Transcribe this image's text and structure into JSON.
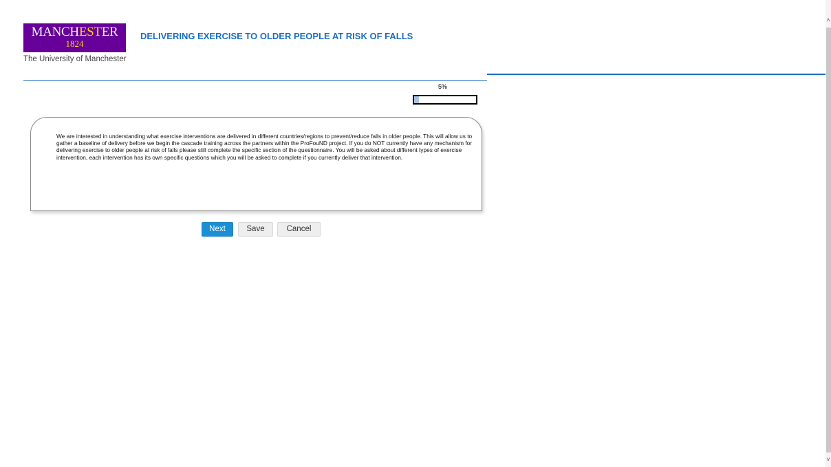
{
  "header": {
    "logo_text_a": "MANCH",
    "logo_text_hl": "EST",
    "logo_text_b": "ER",
    "logo_year": "1824",
    "university_name": "The University of Manchester",
    "title": "DELIVERING EXERCISE TO OLDER PEOPLE AT RISK OF FALLS"
  },
  "progress": {
    "label": "5%",
    "fraction": 0.05
  },
  "intro": {
    "text": "We are interested in understanding what exercise interventions are delivered in different countries/regions to prevent/reduce falls in older people. This will allow us to gather a baseline of delivery before we begin the cascade training across the partners within the ProFouND project. If you do NOT currently have any mechanism for delivering exercise to older people at risk of falls please still complete the specific section of the questionnaire. You will be asked about different types of exercise intervention, each intervention has its own specific questions which you will be asked to complete if you currently deliver that intervention."
  },
  "buttons": {
    "next": "Next",
    "save": "Save",
    "cancel": "Cancel"
  },
  "colors": {
    "brand_purple": "#660099",
    "brand_gold": "#ffcc33",
    "accent_blue": "#1a6fc4",
    "next_button": "#1a8fd6"
  }
}
